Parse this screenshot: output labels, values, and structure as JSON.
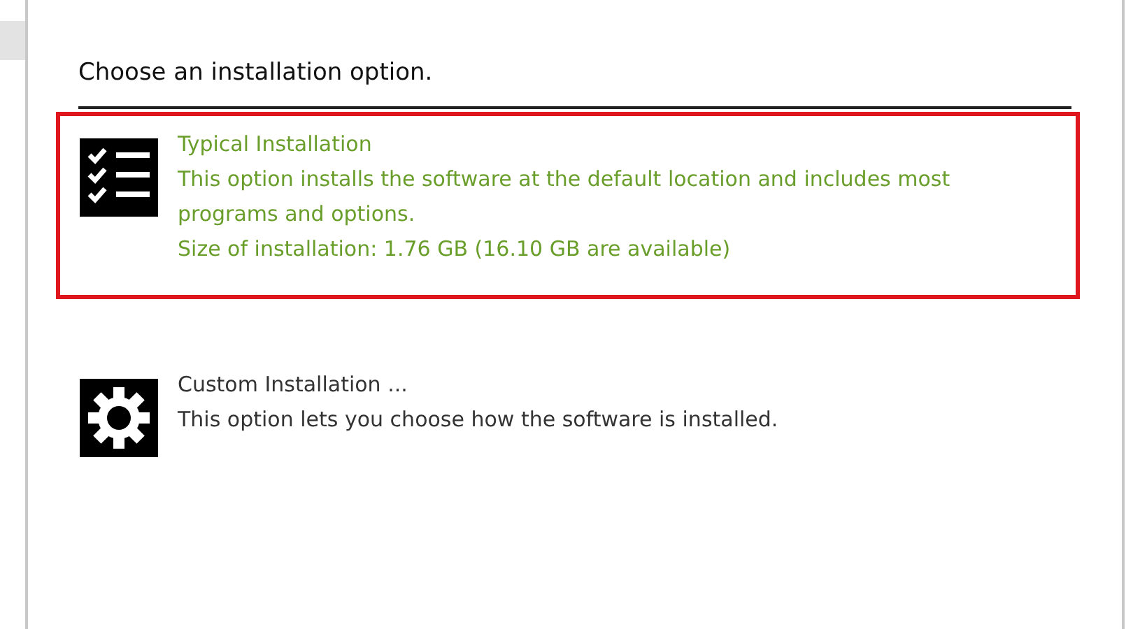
{
  "heading": "Choose an installation option.",
  "options": [
    {
      "kind": "checklist",
      "title": "Typical Installation",
      "selected": true,
      "highlighted": true,
      "lines": [
        "This option installs the software at the default location and includes most programs and options.",
        "Size of installation: 1.76 GB (16.10 GB are available)"
      ]
    },
    {
      "kind": "gear",
      "title": "Custom Installation ...",
      "selected": false,
      "highlighted": false,
      "lines": [
        "This option lets you choose how the software is installed."
      ]
    }
  ]
}
